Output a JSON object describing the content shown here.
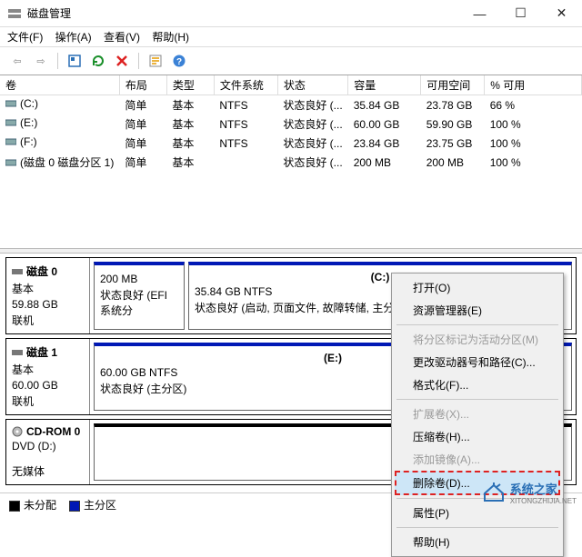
{
  "window": {
    "title": "磁盘管理"
  },
  "menu": {
    "file": "文件(F)",
    "action": "操作(A)",
    "view": "查看(V)",
    "help": "帮助(H)"
  },
  "columns": {
    "vol": "卷",
    "layout": "布局",
    "type": "类型",
    "fs": "文件系统",
    "status": "状态",
    "capacity": "容量",
    "free": "可用空间",
    "pct": "% 可用"
  },
  "rows": [
    {
      "name": "(C:)",
      "layout": "简单",
      "type": "基本",
      "fs": "NTFS",
      "status": "状态良好 (...",
      "cap": "35.84 GB",
      "free": "23.78 GB",
      "pct": "66 %"
    },
    {
      "name": "(E:)",
      "layout": "简单",
      "type": "基本",
      "fs": "NTFS",
      "status": "状态良好 (...",
      "cap": "60.00 GB",
      "free": "59.90 GB",
      "pct": "100 %"
    },
    {
      "name": "(F:)",
      "layout": "简单",
      "type": "基本",
      "fs": "NTFS",
      "status": "状态良好 (...",
      "cap": "23.84 GB",
      "free": "23.75 GB",
      "pct": "100 %"
    },
    {
      "name": "(磁盘 0 磁盘分区 1)",
      "layout": "简单",
      "type": "基本",
      "fs": "",
      "status": "状态良好 (...",
      "cap": "200 MB",
      "free": "200 MB",
      "pct": "100 %"
    }
  ],
  "disk0": {
    "label": "磁盘 0",
    "type": "基本",
    "size": "59.88 GB",
    "state": "联机",
    "p1": {
      "name": "",
      "size": "200 MB",
      "status": "状态良好 (EFI 系统分"
    },
    "p2": {
      "name": "(C:)",
      "size": "35.84 GB NTFS",
      "status": "状态良好 (启动, 页面文件, 故障转储, 主分区)"
    }
  },
  "disk1": {
    "label": "磁盘 1",
    "type": "基本",
    "size": "60.00 GB",
    "state": "联机",
    "p1": {
      "name": "(E:)",
      "size": "60.00 GB NTFS",
      "status": "状态良好 (主分区)"
    }
  },
  "cdrom": {
    "label": "CD-ROM 0",
    "sub": "DVD (D:)",
    "state": "无媒体"
  },
  "legend": {
    "unalloc": "未分配",
    "primary": "主分区"
  },
  "ctx": {
    "open": "打开(O)",
    "explorer": "资源管理器(E)",
    "active": "将分区标记为活动分区(M)",
    "change": "更改驱动器号和路径(C)...",
    "format": "格式化(F)...",
    "extend": "扩展卷(X)...",
    "shrink": "压缩卷(H)...",
    "mirror": "添加镜像(A)...",
    "delete": "删除卷(D)...",
    "props": "属性(P)",
    "help": "帮助(H)"
  },
  "brand": "系统之家",
  "brand_url": "XITONGZHIJIA.NET"
}
